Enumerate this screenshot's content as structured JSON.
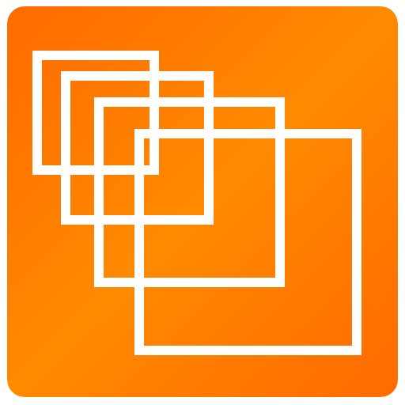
{
  "icon": {
    "name": "overlapping-squares-app-icon",
    "background_gradient": [
      "#FF6A00",
      "#FF8A00",
      "#FF6A00"
    ],
    "stroke_color": "#FFFFFF",
    "square_count": 4
  }
}
